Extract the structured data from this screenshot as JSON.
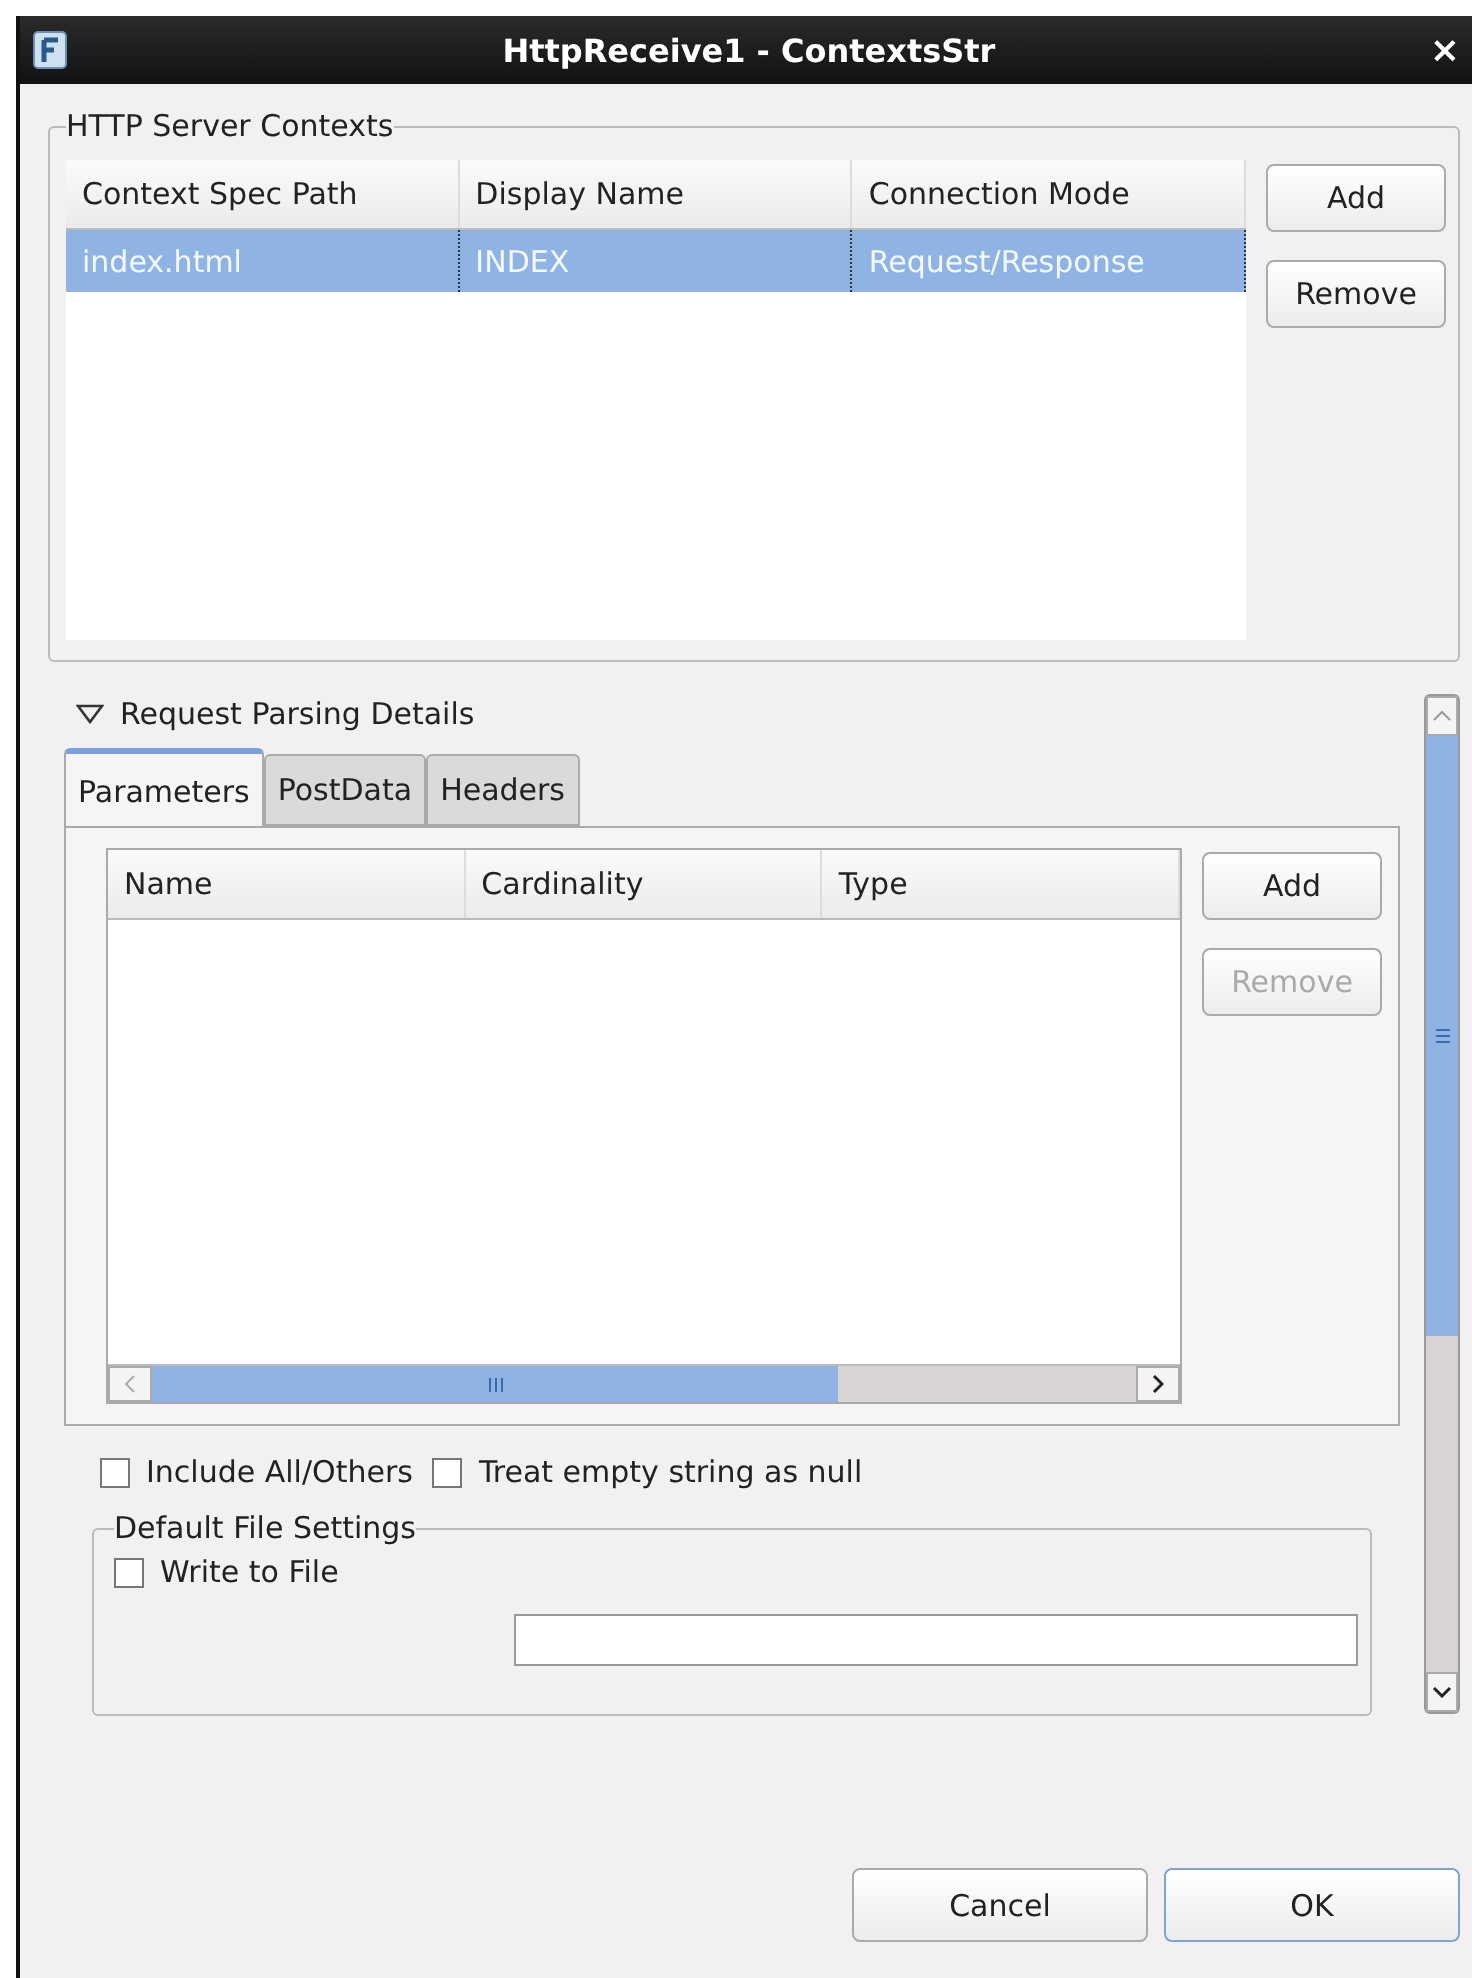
{
  "window": {
    "title": "HttpReceive1 - ContextsStr",
    "close": "×"
  },
  "contexts": {
    "title": "HTTP Server Contexts",
    "columns": [
      "Context Spec Path",
      "Display Name",
      "Connection Mode"
    ],
    "rows": [
      {
        "cells": [
          "index.html",
          "INDEX",
          "Request/Response"
        ],
        "selected": true
      }
    ],
    "buttons": [
      {
        "label": "Add",
        "disabled": false
      },
      {
        "label": "Remove",
        "disabled": false
      }
    ]
  },
  "request_parsing": {
    "title": "Request Parsing Details",
    "expanded": true,
    "tabs": [
      {
        "label": "Parameters",
        "selected": true
      },
      {
        "label": "PostData",
        "selected": false
      },
      {
        "label": "Headers",
        "selected": false
      }
    ],
    "columns": [
      "Name",
      "Cardinality",
      "Type"
    ],
    "buttons": [
      {
        "label": "Add",
        "disabled": false
      },
      {
        "label": "Remove",
        "disabled": true
      }
    ],
    "checkboxes": [
      {
        "label": "Include All/Others",
        "checked": false
      },
      {
        "label": "Treat empty string as null",
        "checked": false
      }
    ],
    "file_settings": {
      "title": "Default File Settings",
      "checkboxes": [
        {
          "label": "Write to File",
          "checked": false
        }
      ]
    }
  },
  "footer": [
    {
      "label": "Cancel",
      "default": false
    },
    {
      "label": "OK",
      "default": true
    }
  ]
}
